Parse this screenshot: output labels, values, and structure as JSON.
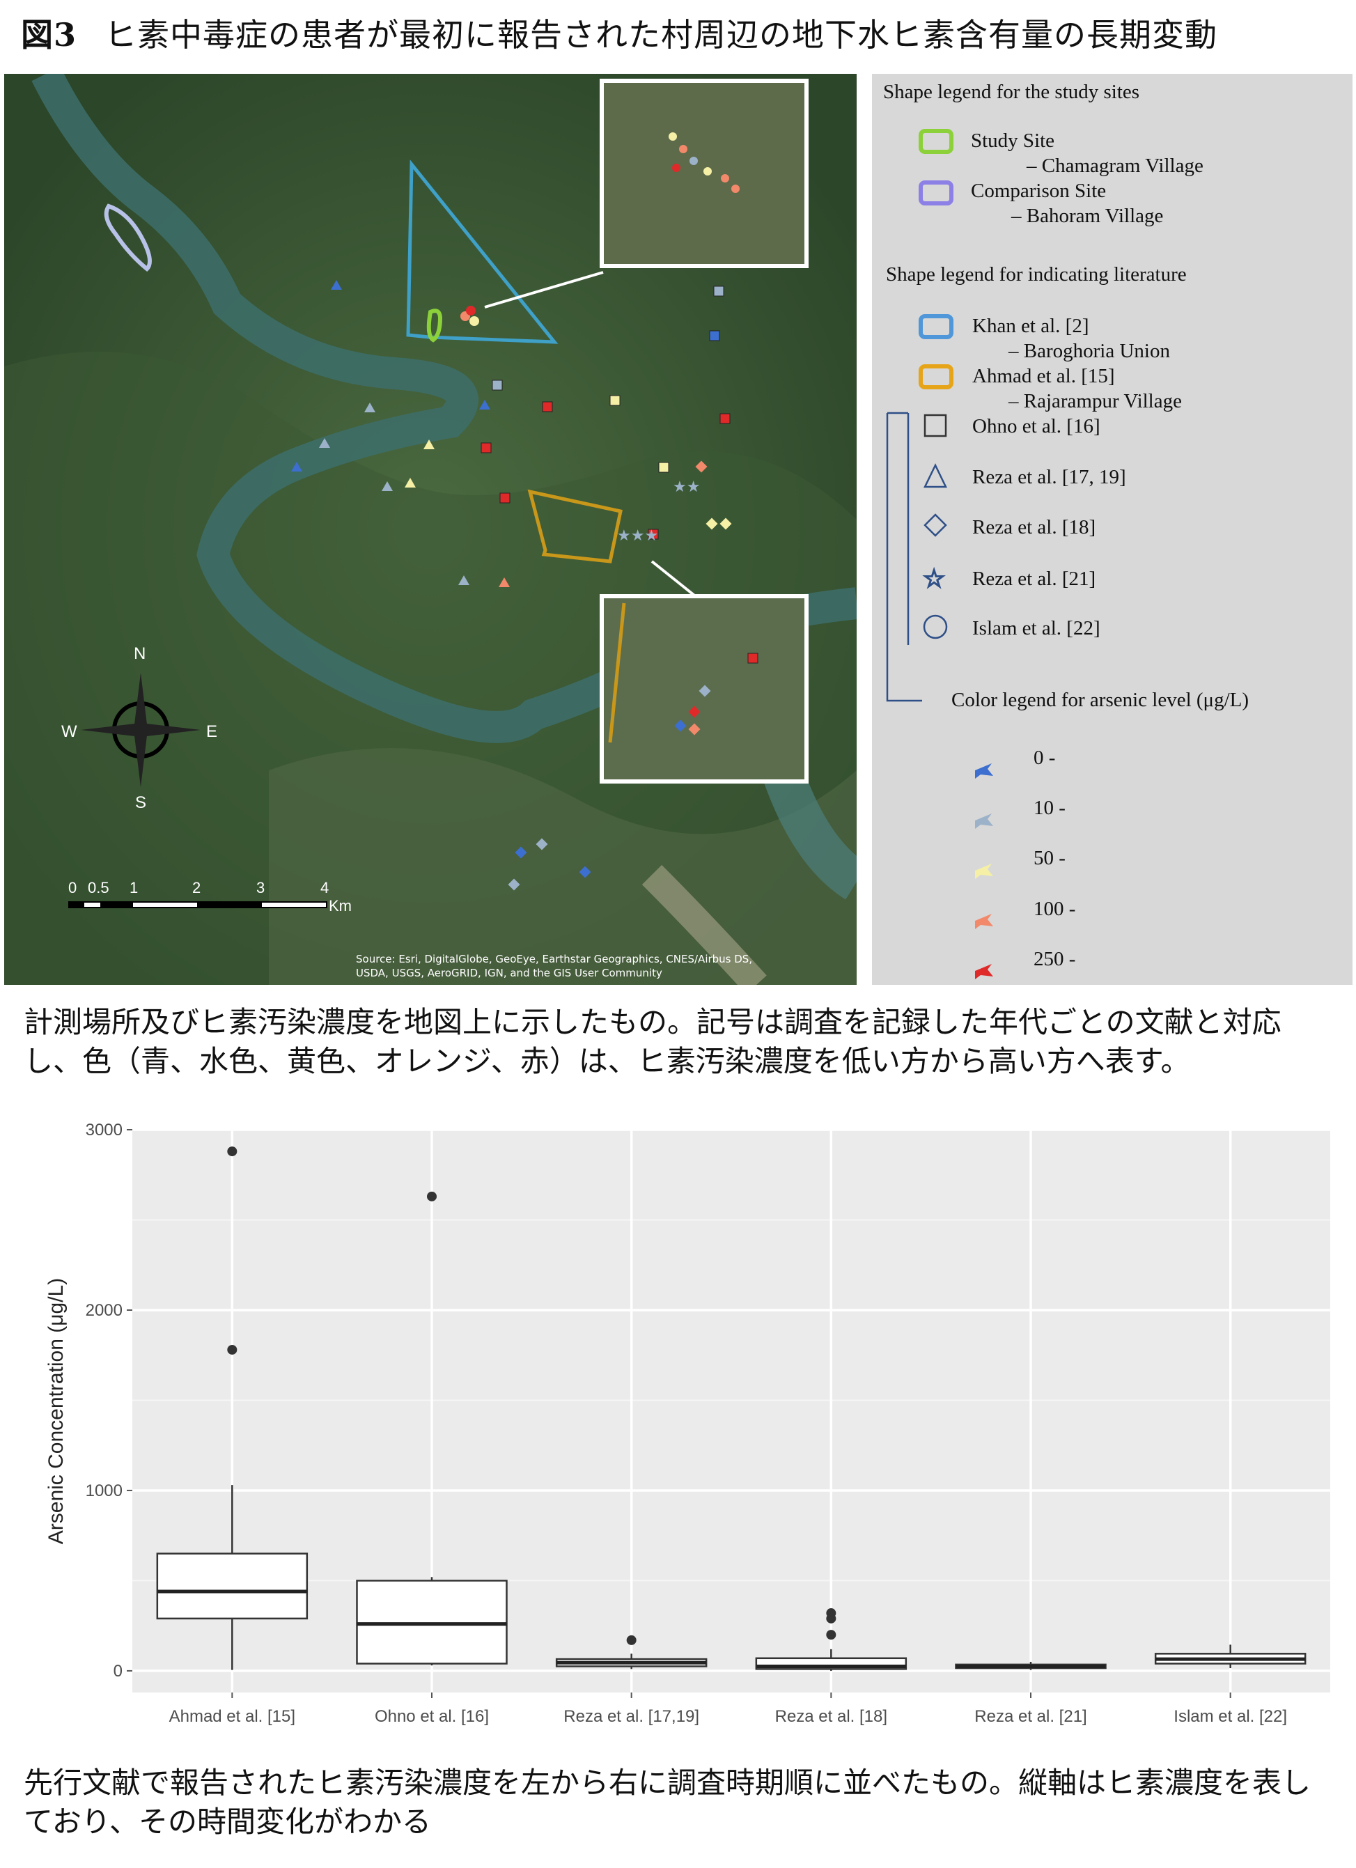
{
  "title": {
    "fig": "図3",
    "text": "ヒ素中毒症の患者が最初に報告された村周辺の地下水ヒ素含有量の長期変動"
  },
  "map": {
    "compass": {
      "n": "N",
      "s": "S",
      "e": "E",
      "w": "W"
    },
    "scale": {
      "ticks": [
        "0",
        "0.5",
        "1",
        "2",
        "3",
        "4"
      ],
      "unit": "Km"
    },
    "source_line1": "Source: Esri, DigitalGlobe, GeoEye, Earthstar Geographics, CNES/Airbus DS,",
    "source_line2": "USDA, USGS, AeroGRID, IGN, and the GIS User Community"
  },
  "legend": {
    "sites_heading": "Shape legend for the study sites",
    "study_site": "Study Site",
    "study_site_sub": "– Chamagram Village",
    "comparison_site": "Comparison Site",
    "comparison_site_sub": "– Bahoram Village",
    "literature_heading": "Shape legend for indicating literature",
    "khan": "Khan et al. [2]",
    "khan_sub": "– Baroghoria Union",
    "ahmad": "Ahmad et al. [15]",
    "ahmad_sub": "– Rajarampur Village",
    "ohno": "Ohno et al. [16]",
    "reza1719": "Reza et al. [17, 19]",
    "reza18": "Reza et al. [18]",
    "reza21": "Reza et al. [21]",
    "islam": "Islam et al. [22]",
    "color_heading": "Color legend for arsenic level (μg/L)",
    "levels": [
      "0 -",
      "10 -",
      "50 -",
      "100 -",
      "250 -"
    ],
    "colors": {
      "study": "#8cd13a",
      "comparison": "#8c7fe6",
      "khan": "#4f97d8",
      "ahmad": "#e6a419",
      "level0": "#3c6fcf",
      "level10": "#9cb2c9",
      "level50": "#f5f0a6",
      "level100": "#f2896a",
      "level250": "#e02a2a"
    }
  },
  "caption1": "計測場所及びヒ素汚染濃度を地図上に示したもの。記号は調査を記録した年代ごとの文献と対応し、色（青、水色、黄色、オレンジ、赤）は、ヒ素汚染濃度を低い方から高い方へ表す。",
  "caption2": "先行文献で報告されたヒ素汚染濃度を左から右に調査時期順に並べたもの。縦軸はヒ素濃度を表しており、その時間変化がわかる",
  "chart_data": {
    "type": "box",
    "ylabel": "Arsenic Concentration (μg/L)",
    "ylim": [
      -120,
      3000
    ],
    "yticks": [
      0,
      1000,
      2000,
      3000
    ],
    "categories": [
      "Ahmad et al. [15]",
      "Ohno et al. [16]",
      "Reza et al. [17,19]",
      "Reza et al. [18]",
      "Reza et al. [21]",
      "Islam et al. [22]"
    ],
    "boxes": [
      {
        "min": 5,
        "q1": 290,
        "median": 440,
        "q3": 650,
        "max": 1030,
        "outliers": [
          1780,
          2880
        ]
      },
      {
        "min": 30,
        "q1": 40,
        "median": 260,
        "q3": 500,
        "max": 520,
        "outliers": [
          2630
        ]
      },
      {
        "min": 10,
        "q1": 25,
        "median": 45,
        "q3": 65,
        "max": 95,
        "outliers": [
          170
        ]
      },
      {
        "min": 0,
        "q1": 10,
        "median": 25,
        "q3": 70,
        "max": 120,
        "outliers": [
          200,
          290,
          320
        ]
      },
      {
        "min": 5,
        "q1": 15,
        "median": 25,
        "q3": 35,
        "max": 50,
        "outliers": []
      },
      {
        "min": 15,
        "q1": 40,
        "median": 65,
        "q3": 95,
        "max": 145,
        "outliers": []
      }
    ],
    "grid": true
  }
}
